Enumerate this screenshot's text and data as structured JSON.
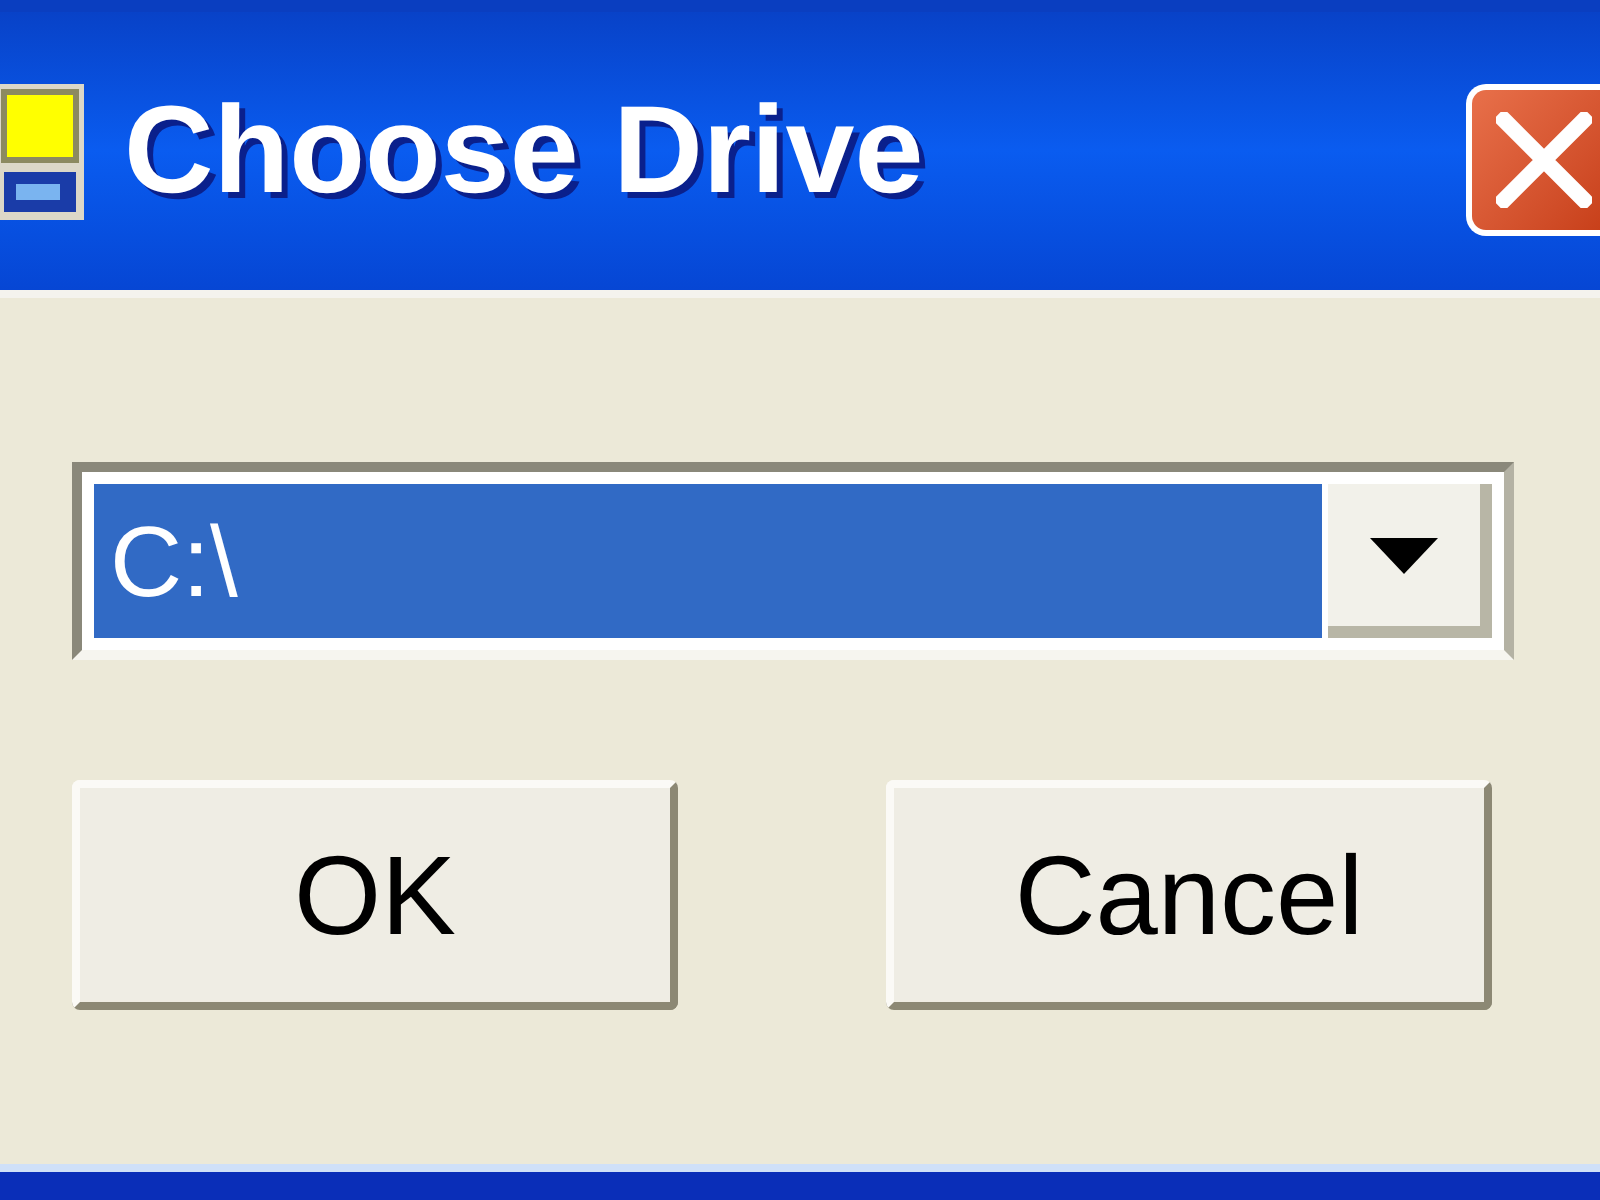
{
  "window": {
    "title": "Choose Drive"
  },
  "drive_select": {
    "value": "C:\\",
    "focused": true
  },
  "buttons": [
    {
      "label": "OK"
    },
    {
      "label": "Cancel"
    }
  ]
}
